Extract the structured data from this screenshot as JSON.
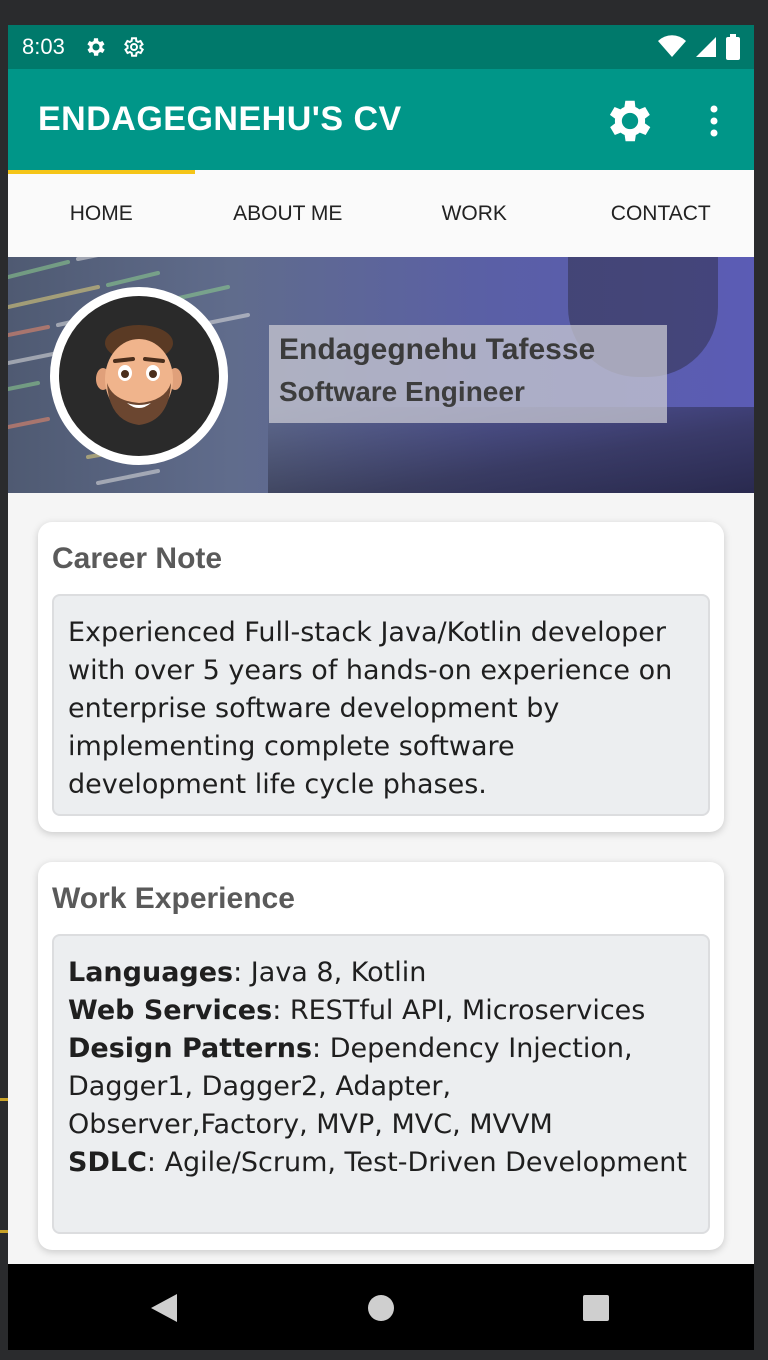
{
  "status_bar": {
    "time": "8:03",
    "icons": [
      "settings-gear-icon",
      "settings-gear-outline-icon",
      "wifi-icon",
      "signal-icon",
      "battery-icon"
    ]
  },
  "app_bar": {
    "title": "ENDAGEGNEHU'S CV",
    "actions": [
      "settings-icon",
      "more-vert-icon"
    ]
  },
  "tabs": [
    {
      "label": "HOME",
      "active": true
    },
    {
      "label": "ABOUT ME",
      "active": false
    },
    {
      "label": "WORK",
      "active": false
    },
    {
      "label": "CONTACT",
      "active": false
    }
  ],
  "profile": {
    "name": "Endagegnehu Tafesse",
    "role": "Software Engineer"
  },
  "career_note": {
    "title": "Career Note",
    "text": "Experienced Full-stack Java/Kotlin developer with over 5 years of hands-on experience on enterprise software development by implementing complete software development life cycle phases."
  },
  "work_experience": {
    "title": "Work Experience",
    "items": [
      {
        "label": "Languages",
        "value": ": Java 8, Kotlin"
      },
      {
        "label": "Web Services",
        "value": ": RESTful API, Microservices"
      },
      {
        "label": "Design Patterns",
        "value": ": Dependency Injection, Dagger1, Dagger2, Adapter, Observer,Factory, MVP, MVC, MVVM"
      },
      {
        "label": "SDLC",
        "value": ": Agile/Scrum, Test-Driven Development"
      }
    ]
  },
  "nav_bar": {
    "buttons": [
      "back-icon",
      "home-icon",
      "recents-icon"
    ]
  },
  "colors": {
    "status_bar": "#00796b",
    "app_bar": "#009688",
    "tab_indicator": "#f5c518"
  }
}
